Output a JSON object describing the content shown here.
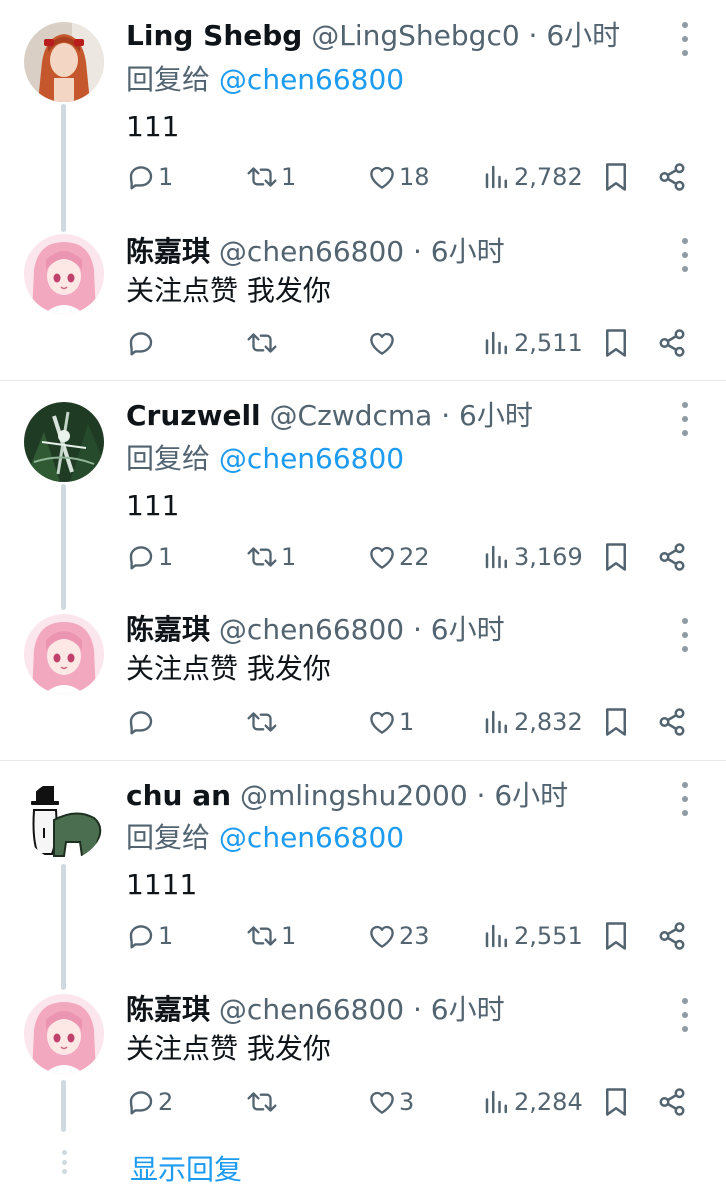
{
  "reply_to_prefix": "回复给",
  "show_replies": "显示回复",
  "tweets": [
    {
      "name": "Ling Shebg",
      "handle": "@LingShebgc0 · 6小时",
      "reply_to": "@chen66800",
      "text": "111",
      "replies": "1",
      "retweets": "1",
      "likes": "18",
      "views": "2,782"
    },
    {
      "name": "陈嘉琪",
      "handle": "@chen66800 · 6小时",
      "text": "关注点赞 我发你",
      "replies": "",
      "retweets": "",
      "likes": "",
      "views": "2,511"
    },
    {
      "name": "Cruzwell",
      "handle": "@Czwdcma · 6小时",
      "reply_to": "@chen66800",
      "text": "111",
      "replies": "1",
      "retweets": "1",
      "likes": "22",
      "views": "3,169"
    },
    {
      "name": "陈嘉琪",
      "handle": "@chen66800 · 6小时",
      "text": "关注点赞 我发你",
      "replies": "",
      "retweets": "",
      "likes": "1",
      "views": "2,832"
    },
    {
      "name": "chu an",
      "handle": "@mlingshu2000 · 6小时",
      "reply_to": "@chen66800",
      "text": "1111",
      "replies": "1",
      "retweets": "1",
      "likes": "23",
      "views": "2,551"
    },
    {
      "name": "陈嘉琪",
      "handle": "@chen66800 · 6小时",
      "text": "关注点赞 我发你",
      "replies": "2",
      "retweets": "",
      "likes": "3",
      "views": "2,284"
    }
  ]
}
